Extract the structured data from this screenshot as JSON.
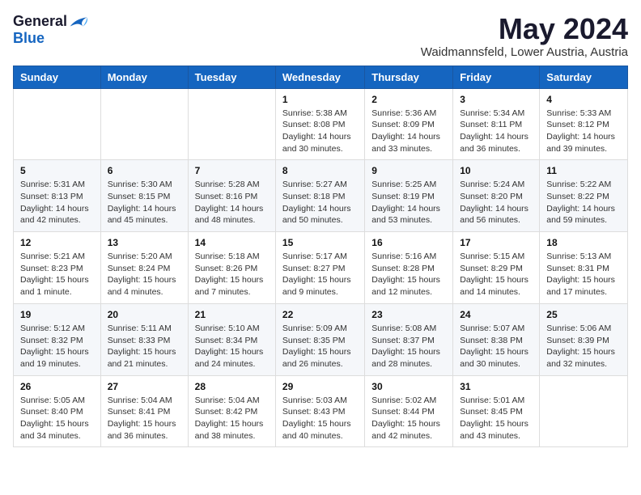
{
  "logo": {
    "general": "General",
    "blue": "Blue"
  },
  "title": "May 2024",
  "location": "Waidmannsfeld, Lower Austria, Austria",
  "days_of_week": [
    "Sunday",
    "Monday",
    "Tuesday",
    "Wednesday",
    "Thursday",
    "Friday",
    "Saturday"
  ],
  "weeks": [
    [
      {
        "day": "",
        "info": ""
      },
      {
        "day": "",
        "info": ""
      },
      {
        "day": "",
        "info": ""
      },
      {
        "day": "1",
        "info": "Sunrise: 5:38 AM\nSunset: 8:08 PM\nDaylight: 14 hours\nand 30 minutes."
      },
      {
        "day": "2",
        "info": "Sunrise: 5:36 AM\nSunset: 8:09 PM\nDaylight: 14 hours\nand 33 minutes."
      },
      {
        "day": "3",
        "info": "Sunrise: 5:34 AM\nSunset: 8:11 PM\nDaylight: 14 hours\nand 36 minutes."
      },
      {
        "day": "4",
        "info": "Sunrise: 5:33 AM\nSunset: 8:12 PM\nDaylight: 14 hours\nand 39 minutes."
      }
    ],
    [
      {
        "day": "5",
        "info": "Sunrise: 5:31 AM\nSunset: 8:13 PM\nDaylight: 14 hours\nand 42 minutes."
      },
      {
        "day": "6",
        "info": "Sunrise: 5:30 AM\nSunset: 8:15 PM\nDaylight: 14 hours\nand 45 minutes."
      },
      {
        "day": "7",
        "info": "Sunrise: 5:28 AM\nSunset: 8:16 PM\nDaylight: 14 hours\nand 48 minutes."
      },
      {
        "day": "8",
        "info": "Sunrise: 5:27 AM\nSunset: 8:18 PM\nDaylight: 14 hours\nand 50 minutes."
      },
      {
        "day": "9",
        "info": "Sunrise: 5:25 AM\nSunset: 8:19 PM\nDaylight: 14 hours\nand 53 minutes."
      },
      {
        "day": "10",
        "info": "Sunrise: 5:24 AM\nSunset: 8:20 PM\nDaylight: 14 hours\nand 56 minutes."
      },
      {
        "day": "11",
        "info": "Sunrise: 5:22 AM\nSunset: 8:22 PM\nDaylight: 14 hours\nand 59 minutes."
      }
    ],
    [
      {
        "day": "12",
        "info": "Sunrise: 5:21 AM\nSunset: 8:23 PM\nDaylight: 15 hours\nand 1 minute."
      },
      {
        "day": "13",
        "info": "Sunrise: 5:20 AM\nSunset: 8:24 PM\nDaylight: 15 hours\nand 4 minutes."
      },
      {
        "day": "14",
        "info": "Sunrise: 5:18 AM\nSunset: 8:26 PM\nDaylight: 15 hours\nand 7 minutes."
      },
      {
        "day": "15",
        "info": "Sunrise: 5:17 AM\nSunset: 8:27 PM\nDaylight: 15 hours\nand 9 minutes."
      },
      {
        "day": "16",
        "info": "Sunrise: 5:16 AM\nSunset: 8:28 PM\nDaylight: 15 hours\nand 12 minutes."
      },
      {
        "day": "17",
        "info": "Sunrise: 5:15 AM\nSunset: 8:29 PM\nDaylight: 15 hours\nand 14 minutes."
      },
      {
        "day": "18",
        "info": "Sunrise: 5:13 AM\nSunset: 8:31 PM\nDaylight: 15 hours\nand 17 minutes."
      }
    ],
    [
      {
        "day": "19",
        "info": "Sunrise: 5:12 AM\nSunset: 8:32 PM\nDaylight: 15 hours\nand 19 minutes."
      },
      {
        "day": "20",
        "info": "Sunrise: 5:11 AM\nSunset: 8:33 PM\nDaylight: 15 hours\nand 21 minutes."
      },
      {
        "day": "21",
        "info": "Sunrise: 5:10 AM\nSunset: 8:34 PM\nDaylight: 15 hours\nand 24 minutes."
      },
      {
        "day": "22",
        "info": "Sunrise: 5:09 AM\nSunset: 8:35 PM\nDaylight: 15 hours\nand 26 minutes."
      },
      {
        "day": "23",
        "info": "Sunrise: 5:08 AM\nSunset: 8:37 PM\nDaylight: 15 hours\nand 28 minutes."
      },
      {
        "day": "24",
        "info": "Sunrise: 5:07 AM\nSunset: 8:38 PM\nDaylight: 15 hours\nand 30 minutes."
      },
      {
        "day": "25",
        "info": "Sunrise: 5:06 AM\nSunset: 8:39 PM\nDaylight: 15 hours\nand 32 minutes."
      }
    ],
    [
      {
        "day": "26",
        "info": "Sunrise: 5:05 AM\nSunset: 8:40 PM\nDaylight: 15 hours\nand 34 minutes."
      },
      {
        "day": "27",
        "info": "Sunrise: 5:04 AM\nSunset: 8:41 PM\nDaylight: 15 hours\nand 36 minutes."
      },
      {
        "day": "28",
        "info": "Sunrise: 5:04 AM\nSunset: 8:42 PM\nDaylight: 15 hours\nand 38 minutes."
      },
      {
        "day": "29",
        "info": "Sunrise: 5:03 AM\nSunset: 8:43 PM\nDaylight: 15 hours\nand 40 minutes."
      },
      {
        "day": "30",
        "info": "Sunrise: 5:02 AM\nSunset: 8:44 PM\nDaylight: 15 hours\nand 42 minutes."
      },
      {
        "day": "31",
        "info": "Sunrise: 5:01 AM\nSunset: 8:45 PM\nDaylight: 15 hours\nand 43 minutes."
      },
      {
        "day": "",
        "info": ""
      }
    ]
  ]
}
